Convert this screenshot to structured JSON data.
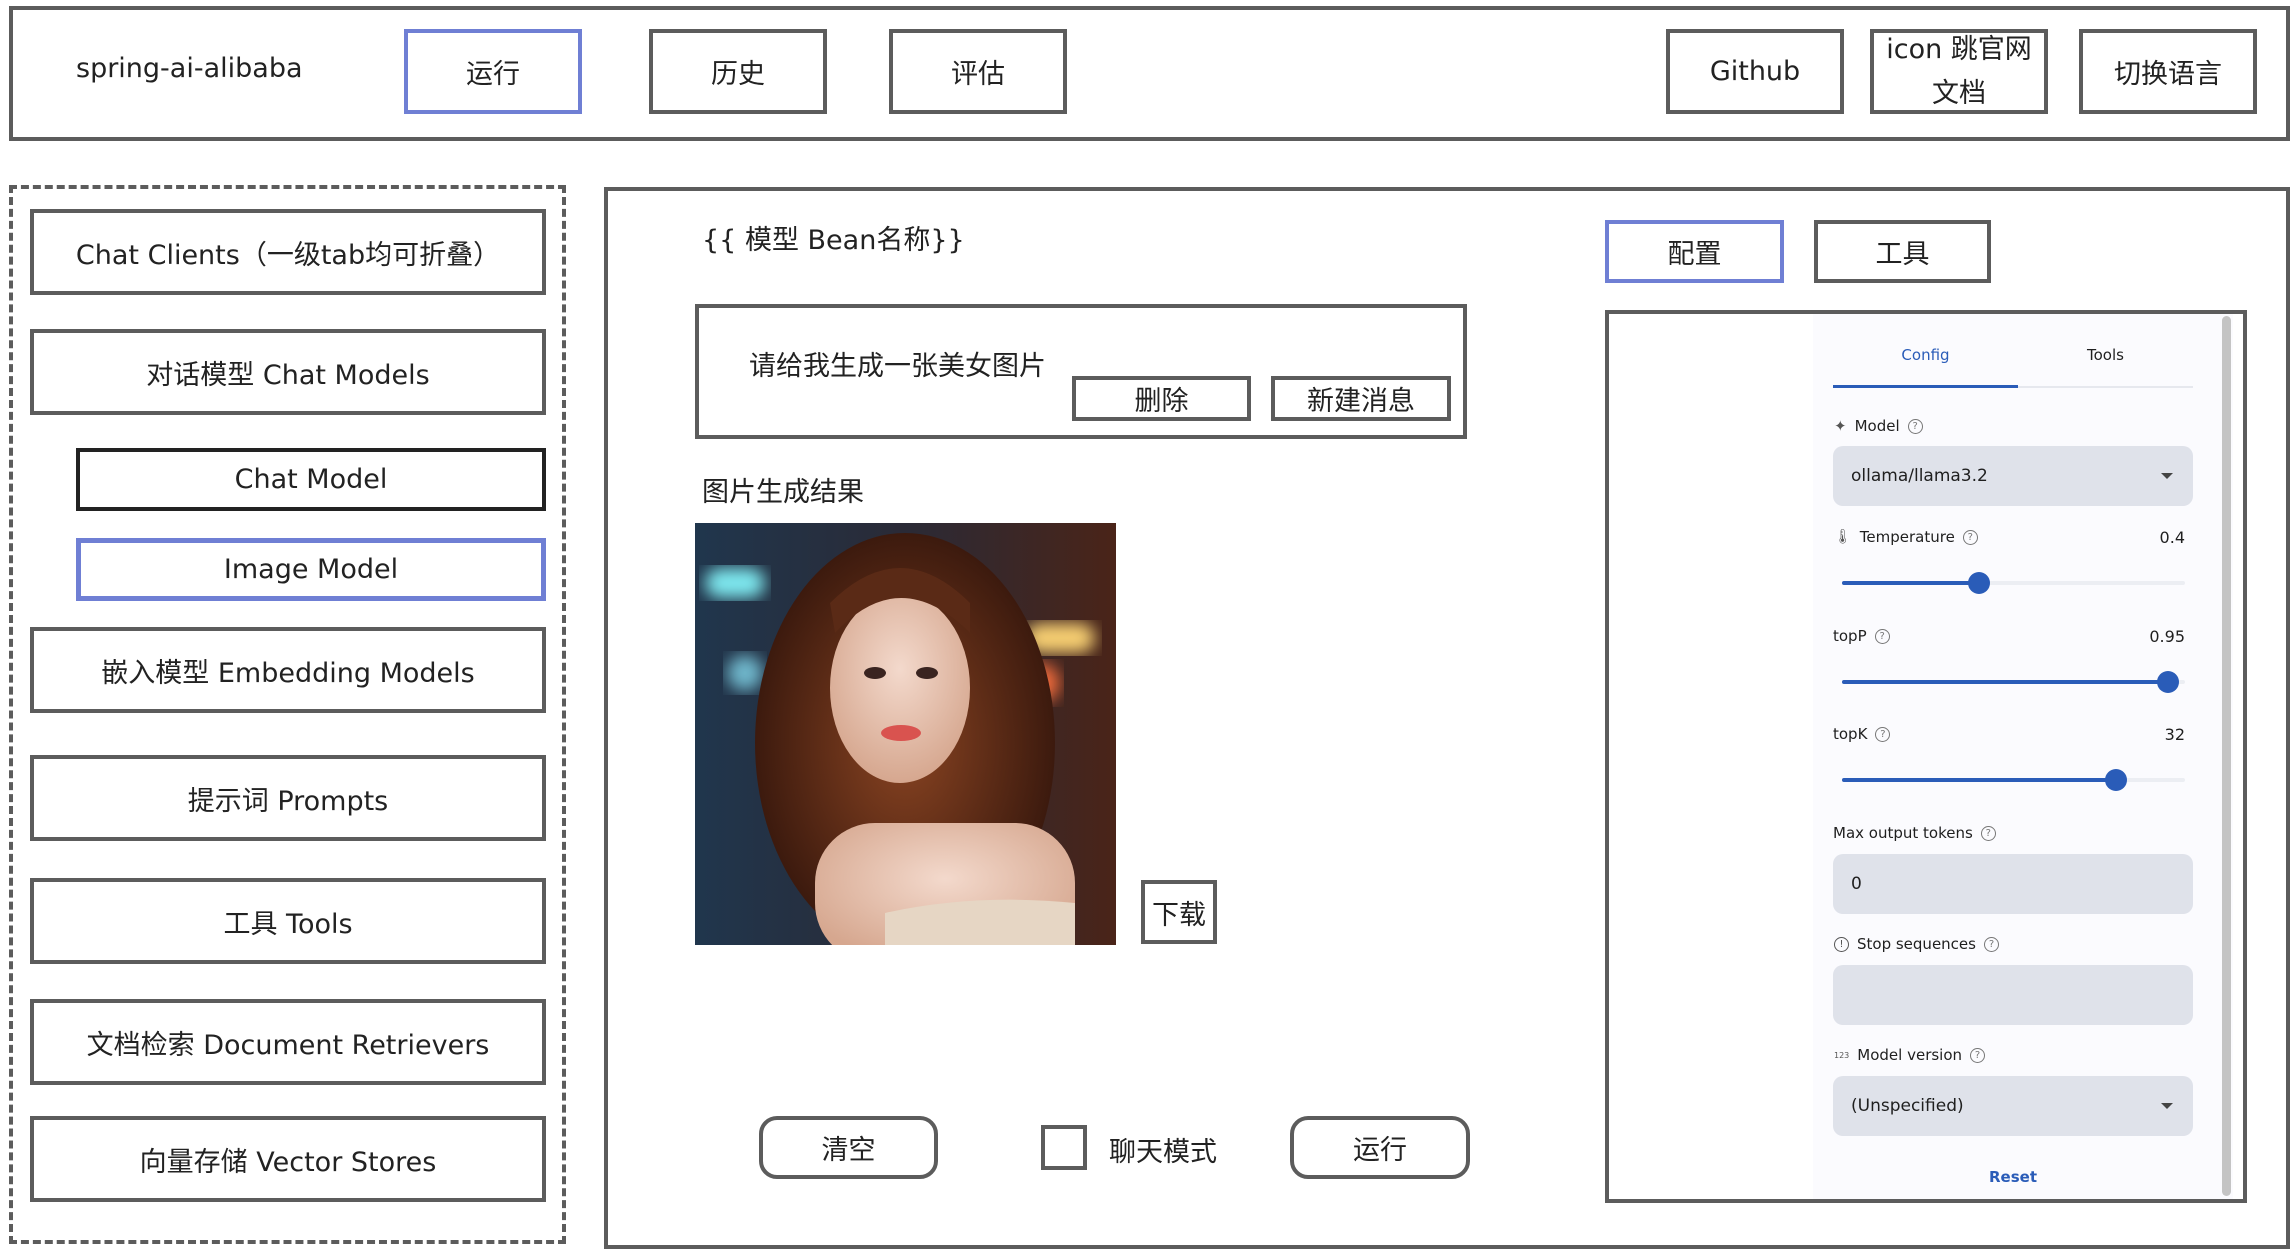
{
  "header": {
    "logo": "spring-ai-alibaba",
    "nav": [
      {
        "label": "运行",
        "active": true
      },
      {
        "label": "历史",
        "active": false
      },
      {
        "label": "评估",
        "active": false
      }
    ],
    "right_buttons": [
      {
        "label": "Github"
      },
      {
        "label_line1": "icon 跳官网",
        "label_line2": "文档"
      },
      {
        "label": "切换语言"
      }
    ]
  },
  "sidebar": {
    "items": [
      {
        "label": "Chat Clients（一级tab均可折叠）"
      },
      {
        "label": "对话模型 Chat Models"
      },
      {
        "label": "Chat Model",
        "sub": true
      },
      {
        "label": "Image Model",
        "sub": true,
        "active": true
      },
      {
        "label": "嵌入模型 Embedding Models"
      },
      {
        "label": "提示词 Prompts"
      },
      {
        "label": "工具 Tools"
      },
      {
        "label": "文档检索 Document Retrievers"
      },
      {
        "label": "向量存储 Vector Stores"
      }
    ]
  },
  "main": {
    "title": "{{ 模型 Bean名称}}",
    "message": {
      "text": "请给我生成一张美女图片",
      "delete_label": "删除",
      "new_label": "新建消息"
    },
    "result_title": "图片生成结果",
    "image_alt": "AI generated portrait of a woman with long wavy auburn hair, bokeh city lights background",
    "download_label": "下载",
    "clear_label": "清空",
    "chat_mode_label": "聊天模式",
    "chat_mode_checked": false,
    "run_label": "运行"
  },
  "right_tabs": [
    {
      "label": "配置",
      "active": true
    },
    {
      "label": "工具",
      "active": false
    }
  ],
  "config": {
    "tabs": [
      {
        "label": "Config",
        "active": true
      },
      {
        "label": "Tools",
        "active": false
      }
    ],
    "model_label": "Model",
    "model_value": "ollama/llama3.2",
    "temperature_label": "Temperature",
    "temperature_value": "0.4",
    "temperature_fraction": 0.4,
    "topp_label": "topP",
    "topp_value": "0.95",
    "topp_fraction": 0.95,
    "topk_label": "topK",
    "topk_value": "32",
    "topk_fraction": 0.8,
    "max_tokens_label": "Max output tokens",
    "max_tokens_value": "0",
    "stop_label": "Stop sequences",
    "stop_value": "",
    "version_label": "Model version",
    "version_value": "(Unspecified)",
    "reset_label": "Reset",
    "accent": "#2a5cb8"
  },
  "colors": {
    "border": "#5c5c5c",
    "active_border": "#6f7fd4",
    "panel_bg": "#fbfbfe",
    "field_bg": "#dfe2ea"
  }
}
